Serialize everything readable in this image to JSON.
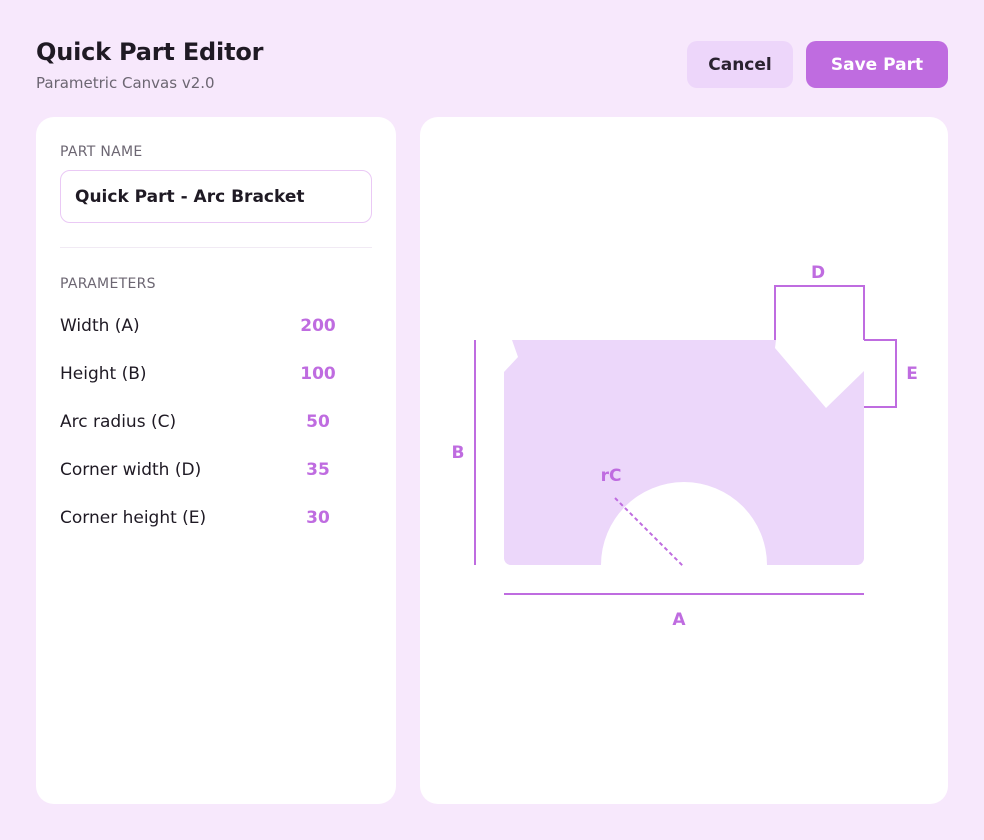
{
  "header": {
    "title": "Quick Part Editor",
    "subtitle": "Parametric Canvas v2.0",
    "cancel_label": "Cancel",
    "save_label": "Save Part"
  },
  "form": {
    "part_name_label": "PART NAME",
    "part_name_value": "Quick Part - Arc Bracket",
    "parameters_label": "PARAMETERS",
    "parameters": [
      {
        "label": "Width (A)",
        "value": "200"
      },
      {
        "label": "Height (B)",
        "value": "100"
      },
      {
        "label": "Arc radius (C)",
        "value": "50"
      },
      {
        "label": "Corner width (D)",
        "value": "35"
      },
      {
        "label": "Corner height (E)",
        "value": "30"
      }
    ]
  },
  "canvas": {
    "dim_a": "A",
    "dim_b": "B",
    "dim_rc": "rC",
    "dim_d": "D",
    "dim_e": "E"
  },
  "colors": {
    "background": "#F7E8FC",
    "accent": "#BF6CE0",
    "shape_fill": "#ECD7FA",
    "secondary_button": "#EDD6FA"
  }
}
